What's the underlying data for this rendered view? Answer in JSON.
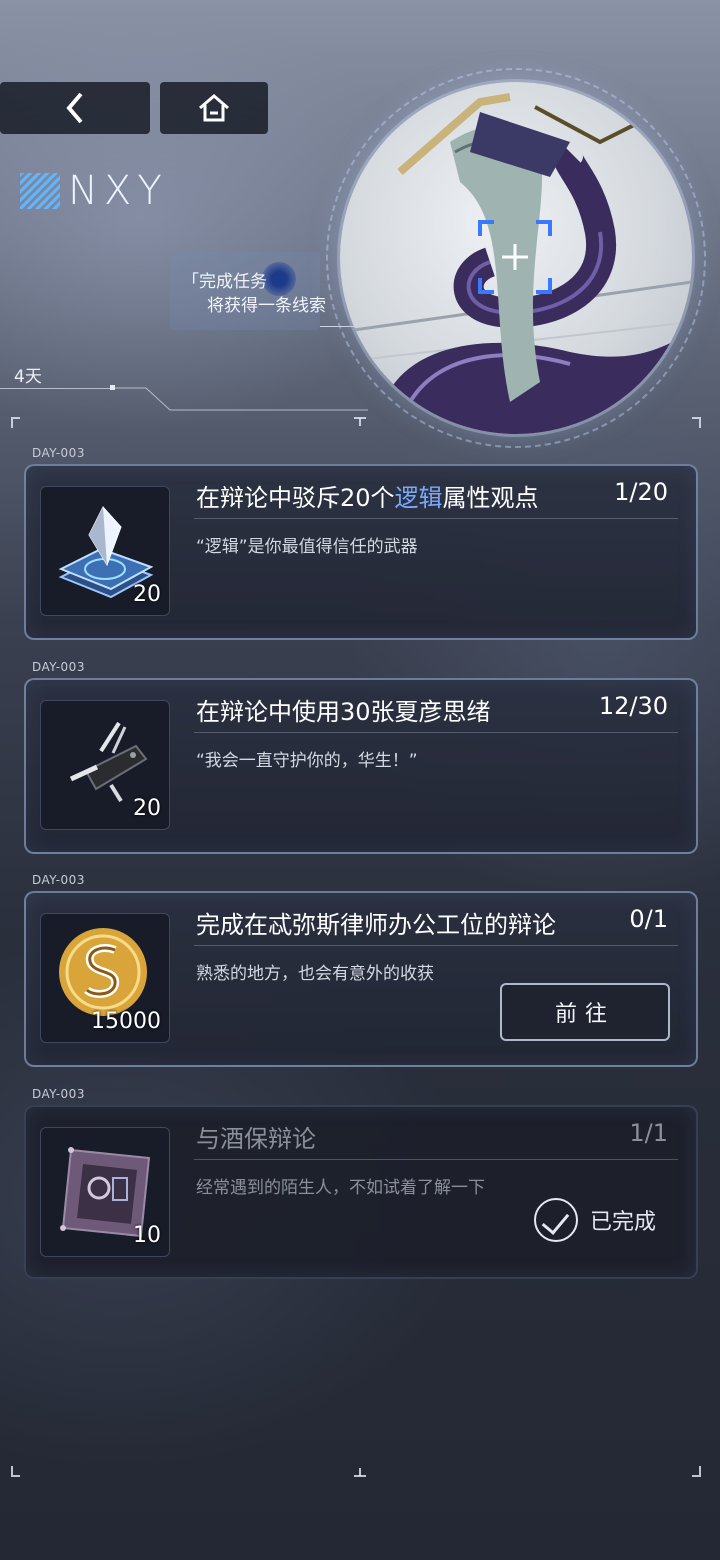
{
  "nav": {
    "back_icon": "chevron-left-icon",
    "home_icon": "home-icon"
  },
  "logo": {
    "text": "NXY"
  },
  "hint": {
    "line1": "「完成任务",
    "line2": "将获得一条线索"
  },
  "days": {
    "label": "4天"
  },
  "tasks": [
    {
      "day": "DAY-003",
      "title_pre": "在辩论中驳斥20个",
      "title_hl": "逻辑",
      "title_post": "属性观点",
      "progress": "1/20",
      "desc": "“逻辑”是你最值得信任的武器",
      "icon": "crystal-card-icon",
      "count": "20"
    },
    {
      "day": "DAY-003",
      "title": "在辩论中使用30张夏彦思绪",
      "progress": "12/30",
      "desc": "“我会一直守护你的，华生！”",
      "icon": "pocket-knife-icon",
      "count": "20"
    },
    {
      "day": "DAY-003",
      "title": "完成在忒弥斯律师办公工位的辩论",
      "progress": "0/1",
      "desc": "熟悉的地方，也会有意外的收获",
      "icon": "gold-coin-icon",
      "count": "15000",
      "action": "前往"
    },
    {
      "day": "DAY-003",
      "title": "与酒保辩论",
      "progress": "1/1",
      "desc": "经常遇到的陌生人，不如试着了解一下",
      "icon": "chip-card-icon",
      "count": "10",
      "status": "已完成"
    }
  ],
  "colors": {
    "highlight": "#7aa8ff",
    "card_border": "#aac3eb",
    "coin_gold": "#d9a53a"
  }
}
